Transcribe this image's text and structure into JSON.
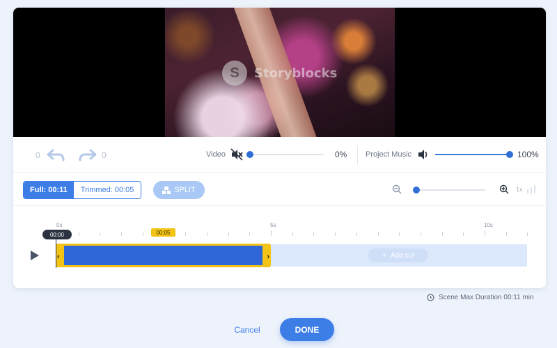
{
  "video": {
    "watermark_text": "Storyblocks",
    "watermark_logo": "S"
  },
  "history": {
    "undo_count": "0",
    "redo_count": "0"
  },
  "audio": {
    "video_label": "Video",
    "video_muted": true,
    "video_volume": 0,
    "video_volume_text": "0%",
    "music_label": "Project Music",
    "music_volume": 100,
    "music_volume_text": "100%"
  },
  "controls": {
    "full_label": "Full: 00:11",
    "trimmed_label": "Trimmed: 00:05",
    "split_label": "SPLIT",
    "speed_label": "1x"
  },
  "timeline": {
    "labels": [
      "0s",
      "5s",
      "10s"
    ],
    "current_time": "00:00",
    "cursor_time": "00:05",
    "add_cut_label": "Add cut",
    "clip_start_seconds": 0,
    "clip_end_seconds": 5,
    "total_seconds": 11
  },
  "footer": {
    "max_duration_text": "Scene Max Duration 00:11 min",
    "cancel_label": "Cancel",
    "done_label": "DONE"
  },
  "colors": {
    "accent": "#3d7ee6",
    "trim_handle": "#f3c316",
    "background": "#eef3fb"
  }
}
